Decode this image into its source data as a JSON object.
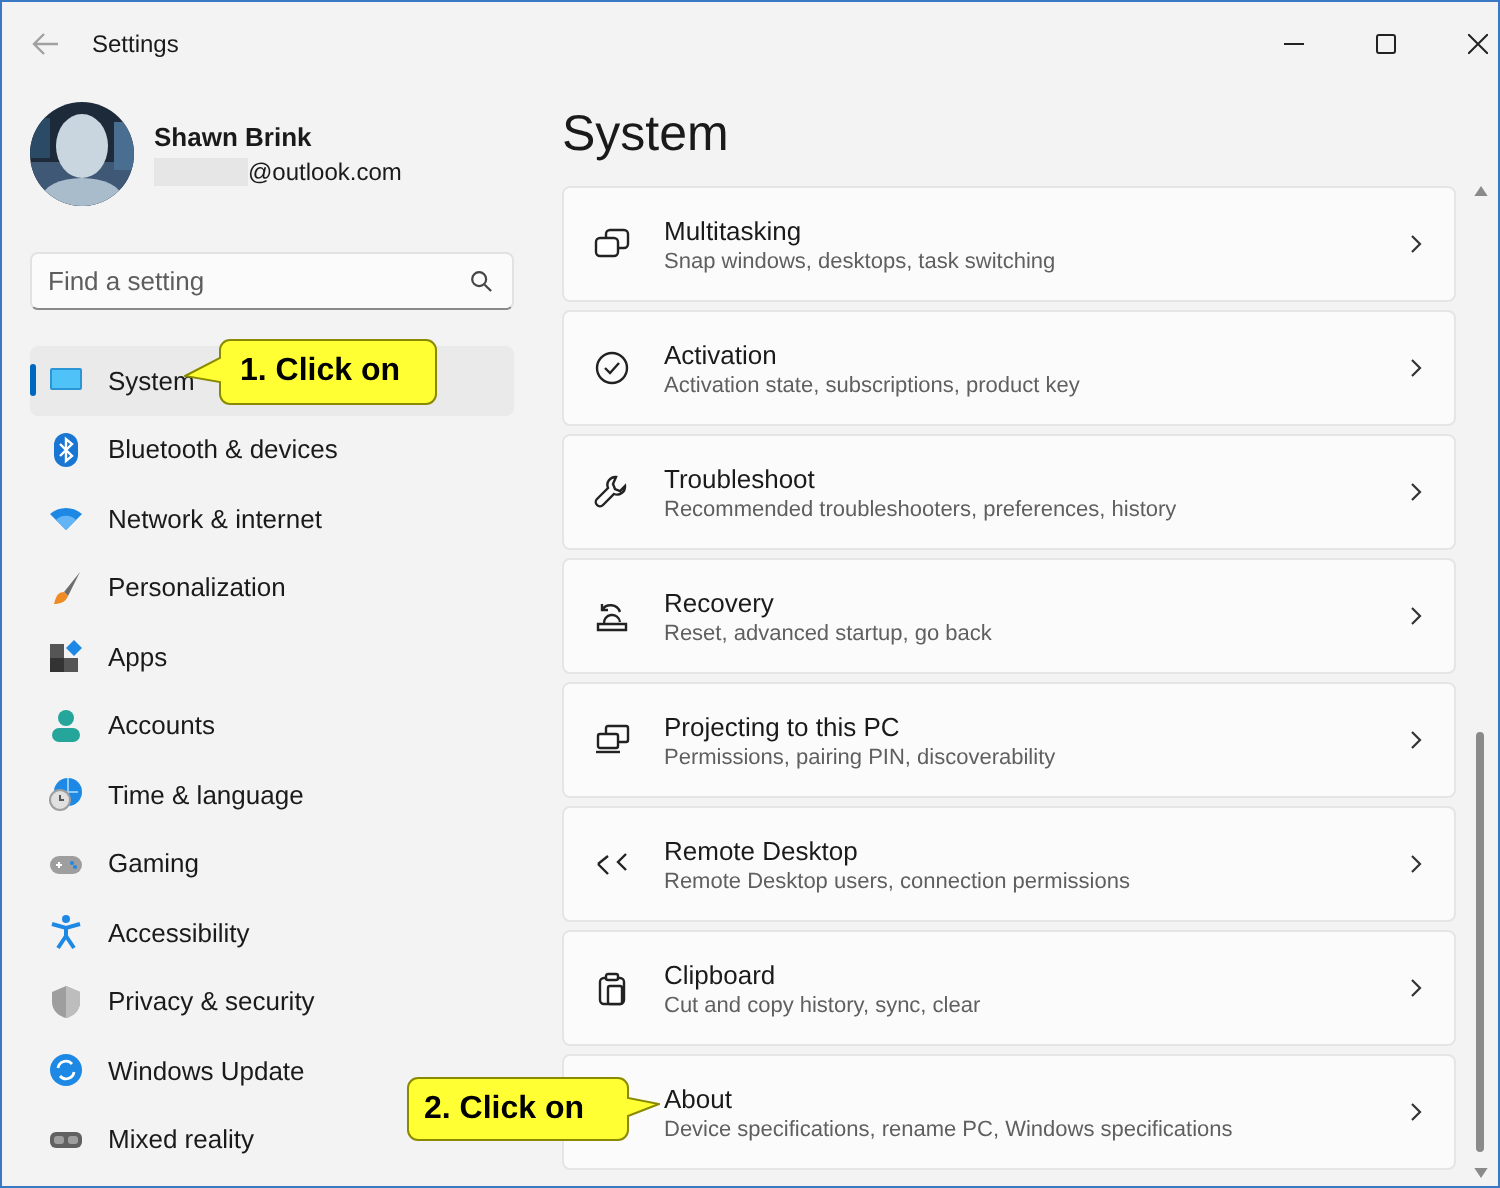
{
  "window": {
    "title": "Settings"
  },
  "profile": {
    "name": "Shawn Brink",
    "email": "@outlook.com"
  },
  "search": {
    "placeholder": "Find a setting"
  },
  "sidebar": {
    "items": [
      {
        "label": "System",
        "selected": true,
        "callout": "1. Click on"
      },
      {
        "label": "Bluetooth & devices",
        "selected": false
      },
      {
        "label": "Network & internet",
        "selected": false
      },
      {
        "label": "Personalization",
        "selected": false
      },
      {
        "label": "Apps",
        "selected": false
      },
      {
        "label": "Accounts",
        "selected": false
      },
      {
        "label": "Time & language",
        "selected": false
      },
      {
        "label": "Gaming",
        "selected": false
      },
      {
        "label": "Accessibility",
        "selected": false
      },
      {
        "label": "Privacy & security",
        "selected": false
      },
      {
        "label": "Windows Update",
        "selected": false
      },
      {
        "label": "Mixed reality",
        "selected": false
      }
    ]
  },
  "page": {
    "title": "System",
    "cards": [
      {
        "title": "Multitasking",
        "description": "Snap windows, desktops, task switching"
      },
      {
        "title": "Activation",
        "description": "Activation state, subscriptions, product key"
      },
      {
        "title": "Troubleshoot",
        "description": "Recommended troubleshooters, preferences, history"
      },
      {
        "title": "Recovery",
        "description": "Reset, advanced startup, go back"
      },
      {
        "title": "Projecting to this PC",
        "description": "Permissions, pairing PIN, discoverability"
      },
      {
        "title": "Remote Desktop",
        "description": "Remote Desktop users, connection permissions"
      },
      {
        "title": "Clipboard",
        "description": "Cut and copy history, sync, clear"
      },
      {
        "title": "About",
        "description": "Device specifications, rename PC, Windows specifications",
        "callout": "2. Click on"
      }
    ]
  }
}
